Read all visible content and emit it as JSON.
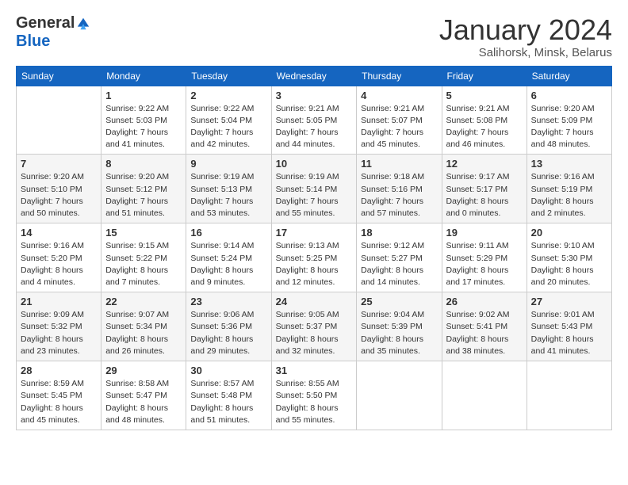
{
  "logo": {
    "general": "General",
    "blue": "Blue"
  },
  "title": "January 2024",
  "subtitle": "Salihorsk, Minsk, Belarus",
  "days_of_week": [
    "Sunday",
    "Monday",
    "Tuesday",
    "Wednesday",
    "Thursday",
    "Friday",
    "Saturday"
  ],
  "weeks": [
    [
      {
        "num": "",
        "info": ""
      },
      {
        "num": "1",
        "info": "Sunrise: 9:22 AM\nSunset: 5:03 PM\nDaylight: 7 hours\nand 41 minutes."
      },
      {
        "num": "2",
        "info": "Sunrise: 9:22 AM\nSunset: 5:04 PM\nDaylight: 7 hours\nand 42 minutes."
      },
      {
        "num": "3",
        "info": "Sunrise: 9:21 AM\nSunset: 5:05 PM\nDaylight: 7 hours\nand 44 minutes."
      },
      {
        "num": "4",
        "info": "Sunrise: 9:21 AM\nSunset: 5:07 PM\nDaylight: 7 hours\nand 45 minutes."
      },
      {
        "num": "5",
        "info": "Sunrise: 9:21 AM\nSunset: 5:08 PM\nDaylight: 7 hours\nand 46 minutes."
      },
      {
        "num": "6",
        "info": "Sunrise: 9:20 AM\nSunset: 5:09 PM\nDaylight: 7 hours\nand 48 minutes."
      }
    ],
    [
      {
        "num": "7",
        "info": "Sunrise: 9:20 AM\nSunset: 5:10 PM\nDaylight: 7 hours\nand 50 minutes."
      },
      {
        "num": "8",
        "info": "Sunrise: 9:20 AM\nSunset: 5:12 PM\nDaylight: 7 hours\nand 51 minutes."
      },
      {
        "num": "9",
        "info": "Sunrise: 9:19 AM\nSunset: 5:13 PM\nDaylight: 7 hours\nand 53 minutes."
      },
      {
        "num": "10",
        "info": "Sunrise: 9:19 AM\nSunset: 5:14 PM\nDaylight: 7 hours\nand 55 minutes."
      },
      {
        "num": "11",
        "info": "Sunrise: 9:18 AM\nSunset: 5:16 PM\nDaylight: 7 hours\nand 57 minutes."
      },
      {
        "num": "12",
        "info": "Sunrise: 9:17 AM\nSunset: 5:17 PM\nDaylight: 8 hours\nand 0 minutes."
      },
      {
        "num": "13",
        "info": "Sunrise: 9:16 AM\nSunset: 5:19 PM\nDaylight: 8 hours\nand 2 minutes."
      }
    ],
    [
      {
        "num": "14",
        "info": "Sunrise: 9:16 AM\nSunset: 5:20 PM\nDaylight: 8 hours\nand 4 minutes."
      },
      {
        "num": "15",
        "info": "Sunrise: 9:15 AM\nSunset: 5:22 PM\nDaylight: 8 hours\nand 7 minutes."
      },
      {
        "num": "16",
        "info": "Sunrise: 9:14 AM\nSunset: 5:24 PM\nDaylight: 8 hours\nand 9 minutes."
      },
      {
        "num": "17",
        "info": "Sunrise: 9:13 AM\nSunset: 5:25 PM\nDaylight: 8 hours\nand 12 minutes."
      },
      {
        "num": "18",
        "info": "Sunrise: 9:12 AM\nSunset: 5:27 PM\nDaylight: 8 hours\nand 14 minutes."
      },
      {
        "num": "19",
        "info": "Sunrise: 9:11 AM\nSunset: 5:29 PM\nDaylight: 8 hours\nand 17 minutes."
      },
      {
        "num": "20",
        "info": "Sunrise: 9:10 AM\nSunset: 5:30 PM\nDaylight: 8 hours\nand 20 minutes."
      }
    ],
    [
      {
        "num": "21",
        "info": "Sunrise: 9:09 AM\nSunset: 5:32 PM\nDaylight: 8 hours\nand 23 minutes."
      },
      {
        "num": "22",
        "info": "Sunrise: 9:07 AM\nSunset: 5:34 PM\nDaylight: 8 hours\nand 26 minutes."
      },
      {
        "num": "23",
        "info": "Sunrise: 9:06 AM\nSunset: 5:36 PM\nDaylight: 8 hours\nand 29 minutes."
      },
      {
        "num": "24",
        "info": "Sunrise: 9:05 AM\nSunset: 5:37 PM\nDaylight: 8 hours\nand 32 minutes."
      },
      {
        "num": "25",
        "info": "Sunrise: 9:04 AM\nSunset: 5:39 PM\nDaylight: 8 hours\nand 35 minutes."
      },
      {
        "num": "26",
        "info": "Sunrise: 9:02 AM\nSunset: 5:41 PM\nDaylight: 8 hours\nand 38 minutes."
      },
      {
        "num": "27",
        "info": "Sunrise: 9:01 AM\nSunset: 5:43 PM\nDaylight: 8 hours\nand 41 minutes."
      }
    ],
    [
      {
        "num": "28",
        "info": "Sunrise: 8:59 AM\nSunset: 5:45 PM\nDaylight: 8 hours\nand 45 minutes."
      },
      {
        "num": "29",
        "info": "Sunrise: 8:58 AM\nSunset: 5:47 PM\nDaylight: 8 hours\nand 48 minutes."
      },
      {
        "num": "30",
        "info": "Sunrise: 8:57 AM\nSunset: 5:48 PM\nDaylight: 8 hours\nand 51 minutes."
      },
      {
        "num": "31",
        "info": "Sunrise: 8:55 AM\nSunset: 5:50 PM\nDaylight: 8 hours\nand 55 minutes."
      },
      {
        "num": "",
        "info": ""
      },
      {
        "num": "",
        "info": ""
      },
      {
        "num": "",
        "info": ""
      }
    ]
  ]
}
